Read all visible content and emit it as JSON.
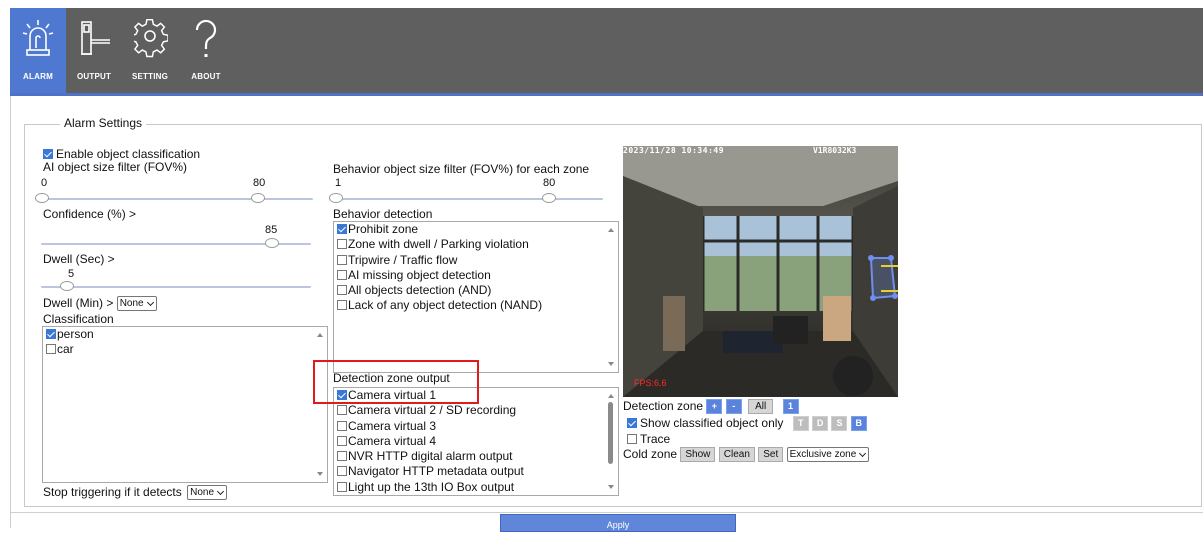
{
  "nav": {
    "items": [
      {
        "label": "ALARM",
        "icon": "alarm-siren-icon",
        "active": true
      },
      {
        "label": "OUTPUT",
        "icon": "output-barrier-icon",
        "active": false
      },
      {
        "label": "SETTING",
        "icon": "gear-icon",
        "active": false
      },
      {
        "label": "ABOUT",
        "icon": "question-mark-icon",
        "active": false
      }
    ]
  },
  "section": {
    "legend": "Alarm Settings"
  },
  "classification_panel": {
    "enable_label": "Enable object classification",
    "enable_checked": true,
    "ai_size_label": "AI object size filter (FOV%)",
    "ai_size_min": "0",
    "ai_size_max": "80",
    "confidence_label": "Confidence (%) >",
    "confidence_value": "85",
    "dwell_sec_label": "Dwell (Sec) >",
    "dwell_sec_value": "5",
    "dwell_min_label": "Dwell (Min) >",
    "dwell_min_value": "None",
    "classification_label": "Classification",
    "classes": [
      {
        "label": "person",
        "checked": true
      },
      {
        "label": "car",
        "checked": false
      }
    ],
    "stop_label": "Stop triggering if it detects",
    "stop_value": "None"
  },
  "behavior_panel": {
    "size_label": "Behavior object size filter (FOV%) for each zone",
    "size_min": "1",
    "size_max": "80",
    "detection_label": "Behavior detection",
    "behaviors": [
      {
        "label": "Prohibit zone",
        "checked": true
      },
      {
        "label": "Zone with dwell / Parking violation",
        "checked": false
      },
      {
        "label": "Tripwire / Traffic flow",
        "checked": false
      },
      {
        "label": "AI missing object detection",
        "checked": false
      },
      {
        "label": "All objects detection (AND)",
        "checked": false
      },
      {
        "label": "Lack of any object detection (NAND)",
        "checked": false
      }
    ],
    "output_label": "Detection zone output",
    "outputs": [
      {
        "label": "Camera virtual 1",
        "checked": true
      },
      {
        "label": "Camera virtual 2 / SD recording",
        "checked": false
      },
      {
        "label": "Camera virtual 3",
        "checked": false
      },
      {
        "label": "Camera virtual 4",
        "checked": false
      },
      {
        "label": "NVR HTTP digital alarm output",
        "checked": false
      },
      {
        "label": "Navigator HTTP metadata output",
        "checked": false
      },
      {
        "label": "Light up the 13th IO Box output",
        "checked": false
      }
    ]
  },
  "camera": {
    "timestamp": "2023/11/28 10:34:49",
    "camera_id": "V1R8032K3",
    "fps": "FPS:6.6"
  },
  "zone_controls": {
    "detection_zone_label": "Detection zone",
    "add": "+",
    "remove": "-",
    "all": "All",
    "zone_number": "1",
    "show_classified_label": "Show classified object only",
    "show_classified_checked": true,
    "tags": [
      "T",
      "D",
      "S",
      "B"
    ],
    "trace_label": "Trace",
    "trace_checked": false,
    "cold_zone_label": "Cold zone",
    "show": "Show",
    "clean": "Clean",
    "set": "Set",
    "zone_mode": "Exclusive zone"
  },
  "footer": {
    "apply": "Apply"
  },
  "colors": {
    "accent": "#4f79d1",
    "toolbar": "#5f5f5f",
    "highlight": "#e01b1b"
  }
}
